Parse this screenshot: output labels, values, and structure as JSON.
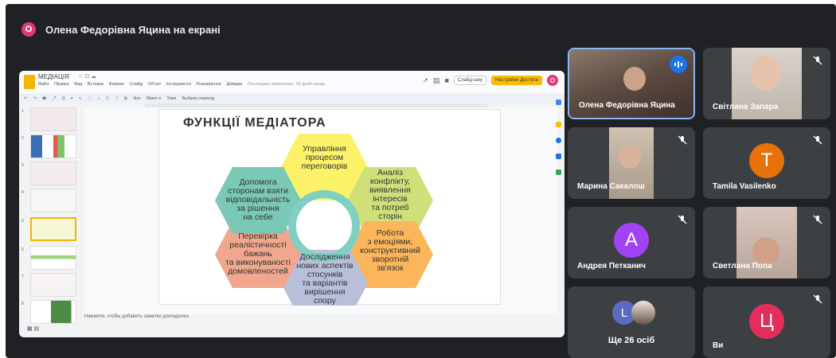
{
  "presenting": {
    "avatar_letter": "О",
    "text": "Олена Федорівна Яцина на екрані"
  },
  "slides_app": {
    "doc_title": "МЕДІАЦІЯ",
    "title_icons": "☆ ⊡ ☁",
    "menu": [
      "Файл",
      "Правка",
      "Вид",
      "Вставка",
      "Формат",
      "Слайд",
      "Обʼєкт",
      "Інструменти",
      "Розширення",
      "Довідка"
    ],
    "saved_status": "Последнее изменение: 18 дней назад",
    "slideshow_label": "Слайд-шоу",
    "access_label": "Настройки Доступа",
    "user_letter": "О",
    "toolbar": [
      "↶",
      "↷",
      "🖶",
      "⤴",
      "Q",
      "▾",
      "↖",
      "⬚",
      "⌂",
      "⬡",
      "⟋",
      "⊞",
      "Фон",
      "Макет ▾",
      "Тема",
      "Выбрать переход"
    ],
    "notes_placeholder": "Нажмите, чтобы добавить заметки докладчика"
  },
  "slide": {
    "title": "ФУНКЦІЇ МЕДІАТОРА",
    "hexagons": [
      {
        "id": "top",
        "lines": [
          "Управління",
          "процесом",
          "переговорів"
        ],
        "color": "#fbf26a"
      },
      {
        "id": "upper-right",
        "lines": [
          "Аналіз",
          "конфлікту,",
          "виявлення",
          "інтересів",
          "та потреб",
          "сторін"
        ],
        "color": "#cfe07a"
      },
      {
        "id": "lower-right",
        "lines": [
          "Робота",
          "з емоціями,",
          "конструктивний",
          "зворотній",
          "зв'язок"
        ],
        "color": "#fbb55a"
      },
      {
        "id": "bottom",
        "lines": [
          "Дослідження",
          "нових аспектів",
          "стосунків",
          "та варіантів",
          "вирішення",
          "спору"
        ],
        "color": "#b9bfd8"
      },
      {
        "id": "lower-left",
        "lines": [
          "Перевірка",
          "реалістичності",
          "бажань",
          "та виконуваності",
          "домовленостей"
        ],
        "color": "#f0a78e"
      },
      {
        "id": "upper-left",
        "lines": [
          "Допомога",
          "сторонам взяти",
          "відповідальність",
          "за рішення",
          "на себе"
        ],
        "color": "#7ac9b6"
      }
    ]
  },
  "thumbnails": [
    "1",
    "2",
    "3",
    "4",
    "5",
    "6",
    "7",
    "8"
  ],
  "participants": [
    {
      "name": "Олена Федорівна Яцина",
      "type": "video",
      "speaking": true
    },
    {
      "name": "Світлана Запара",
      "type": "video",
      "muted": true
    },
    {
      "name": "Марина Сакалош",
      "type": "video",
      "muted": true
    },
    {
      "name": "Tamila Vasilenko",
      "type": "avatar",
      "letter": "T",
      "color": "#e8710a",
      "muted": true
    },
    {
      "name": "Андрея Петканич",
      "type": "avatar",
      "letter": "А",
      "color": "#a142f4",
      "muted": true
    },
    {
      "name": "Светлана Попа",
      "type": "video",
      "muted": true
    },
    {
      "name": "Ще 26 осіб",
      "type": "more",
      "letter": "L",
      "color": "#5c6bc0"
    },
    {
      "name": "Ви",
      "type": "avatar",
      "letter": "Ц",
      "color": "#e52d5c",
      "muted": true
    }
  ]
}
